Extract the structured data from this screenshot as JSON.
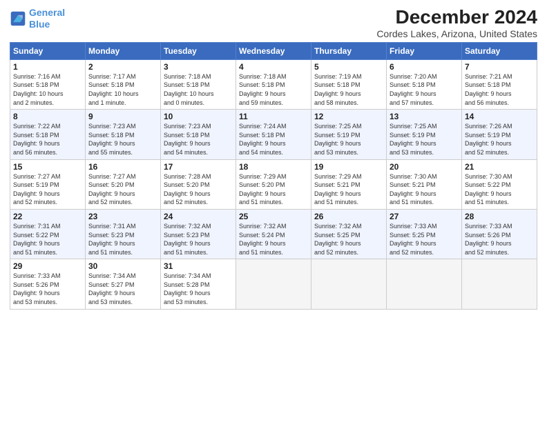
{
  "header": {
    "logo_line1": "General",
    "logo_line2": "Blue",
    "title": "December 2024",
    "subtitle": "Cordes Lakes, Arizona, United States"
  },
  "columns": [
    "Sunday",
    "Monday",
    "Tuesday",
    "Wednesday",
    "Thursday",
    "Friday",
    "Saturday"
  ],
  "weeks": [
    [
      {
        "day": "1",
        "info": "Sunrise: 7:16 AM\nSunset: 5:18 PM\nDaylight: 10 hours\nand 2 minutes."
      },
      {
        "day": "2",
        "info": "Sunrise: 7:17 AM\nSunset: 5:18 PM\nDaylight: 10 hours\nand 1 minute."
      },
      {
        "day": "3",
        "info": "Sunrise: 7:18 AM\nSunset: 5:18 PM\nDaylight: 10 hours\nand 0 minutes."
      },
      {
        "day": "4",
        "info": "Sunrise: 7:18 AM\nSunset: 5:18 PM\nDaylight: 9 hours\nand 59 minutes."
      },
      {
        "day": "5",
        "info": "Sunrise: 7:19 AM\nSunset: 5:18 PM\nDaylight: 9 hours\nand 58 minutes."
      },
      {
        "day": "6",
        "info": "Sunrise: 7:20 AM\nSunset: 5:18 PM\nDaylight: 9 hours\nand 57 minutes."
      },
      {
        "day": "7",
        "info": "Sunrise: 7:21 AM\nSunset: 5:18 PM\nDaylight: 9 hours\nand 56 minutes."
      }
    ],
    [
      {
        "day": "8",
        "info": "Sunrise: 7:22 AM\nSunset: 5:18 PM\nDaylight: 9 hours\nand 56 minutes."
      },
      {
        "day": "9",
        "info": "Sunrise: 7:23 AM\nSunset: 5:18 PM\nDaylight: 9 hours\nand 55 minutes."
      },
      {
        "day": "10",
        "info": "Sunrise: 7:23 AM\nSunset: 5:18 PM\nDaylight: 9 hours\nand 54 minutes."
      },
      {
        "day": "11",
        "info": "Sunrise: 7:24 AM\nSunset: 5:18 PM\nDaylight: 9 hours\nand 54 minutes."
      },
      {
        "day": "12",
        "info": "Sunrise: 7:25 AM\nSunset: 5:19 PM\nDaylight: 9 hours\nand 53 minutes."
      },
      {
        "day": "13",
        "info": "Sunrise: 7:25 AM\nSunset: 5:19 PM\nDaylight: 9 hours\nand 53 minutes."
      },
      {
        "day": "14",
        "info": "Sunrise: 7:26 AM\nSunset: 5:19 PM\nDaylight: 9 hours\nand 52 minutes."
      }
    ],
    [
      {
        "day": "15",
        "info": "Sunrise: 7:27 AM\nSunset: 5:19 PM\nDaylight: 9 hours\nand 52 minutes."
      },
      {
        "day": "16",
        "info": "Sunrise: 7:27 AM\nSunset: 5:20 PM\nDaylight: 9 hours\nand 52 minutes."
      },
      {
        "day": "17",
        "info": "Sunrise: 7:28 AM\nSunset: 5:20 PM\nDaylight: 9 hours\nand 52 minutes."
      },
      {
        "day": "18",
        "info": "Sunrise: 7:29 AM\nSunset: 5:20 PM\nDaylight: 9 hours\nand 51 minutes."
      },
      {
        "day": "19",
        "info": "Sunrise: 7:29 AM\nSunset: 5:21 PM\nDaylight: 9 hours\nand 51 minutes."
      },
      {
        "day": "20",
        "info": "Sunrise: 7:30 AM\nSunset: 5:21 PM\nDaylight: 9 hours\nand 51 minutes."
      },
      {
        "day": "21",
        "info": "Sunrise: 7:30 AM\nSunset: 5:22 PM\nDaylight: 9 hours\nand 51 minutes."
      }
    ],
    [
      {
        "day": "22",
        "info": "Sunrise: 7:31 AM\nSunset: 5:22 PM\nDaylight: 9 hours\nand 51 minutes."
      },
      {
        "day": "23",
        "info": "Sunrise: 7:31 AM\nSunset: 5:23 PM\nDaylight: 9 hours\nand 51 minutes."
      },
      {
        "day": "24",
        "info": "Sunrise: 7:32 AM\nSunset: 5:23 PM\nDaylight: 9 hours\nand 51 minutes."
      },
      {
        "day": "25",
        "info": "Sunrise: 7:32 AM\nSunset: 5:24 PM\nDaylight: 9 hours\nand 51 minutes."
      },
      {
        "day": "26",
        "info": "Sunrise: 7:32 AM\nSunset: 5:25 PM\nDaylight: 9 hours\nand 52 minutes."
      },
      {
        "day": "27",
        "info": "Sunrise: 7:33 AM\nSunset: 5:25 PM\nDaylight: 9 hours\nand 52 minutes."
      },
      {
        "day": "28",
        "info": "Sunrise: 7:33 AM\nSunset: 5:26 PM\nDaylight: 9 hours\nand 52 minutes."
      }
    ],
    [
      {
        "day": "29",
        "info": "Sunrise: 7:33 AM\nSunset: 5:26 PM\nDaylight: 9 hours\nand 53 minutes."
      },
      {
        "day": "30",
        "info": "Sunrise: 7:34 AM\nSunset: 5:27 PM\nDaylight: 9 hours\nand 53 minutes."
      },
      {
        "day": "31",
        "info": "Sunrise: 7:34 AM\nSunset: 5:28 PM\nDaylight: 9 hours\nand 53 minutes."
      },
      {
        "day": "",
        "info": ""
      },
      {
        "day": "",
        "info": ""
      },
      {
        "day": "",
        "info": ""
      },
      {
        "day": "",
        "info": ""
      }
    ]
  ]
}
